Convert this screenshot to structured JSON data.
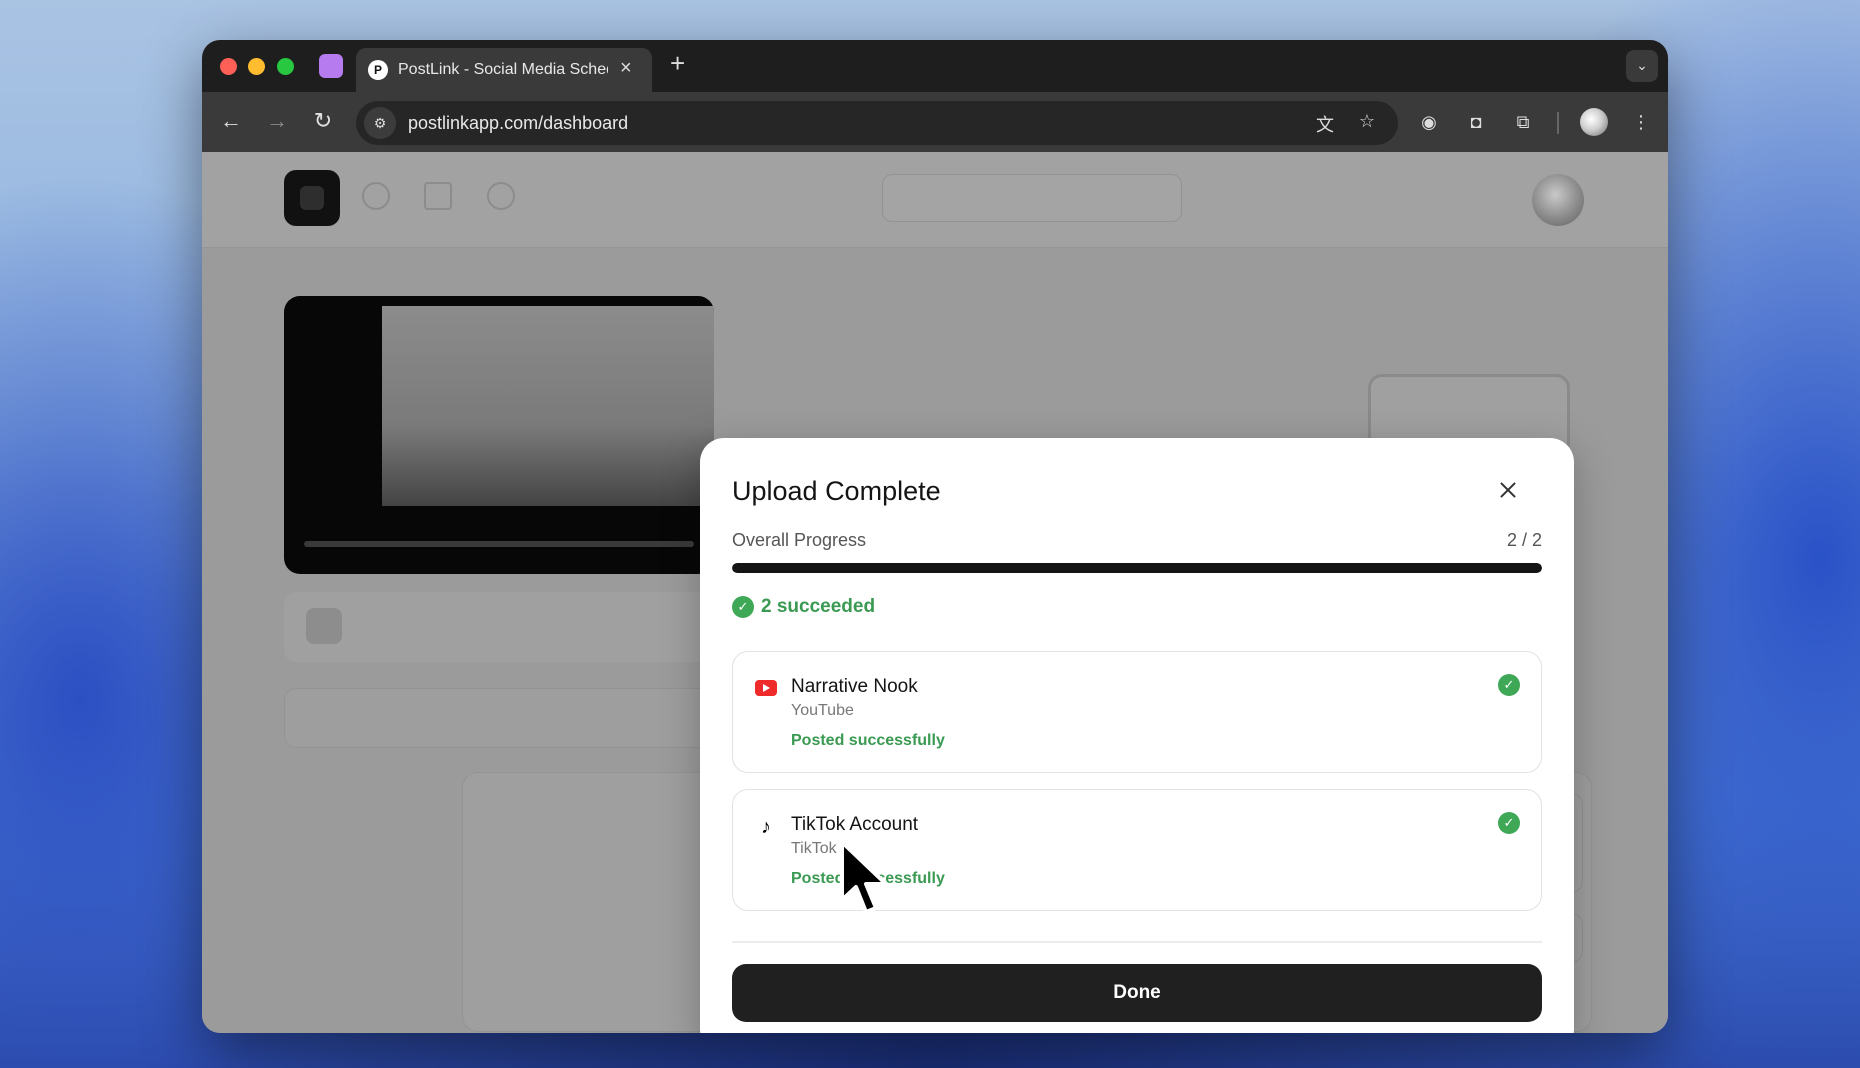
{
  "browser": {
    "tab_title": "PostLink - Social Media Scheduler",
    "tab_favicon": "P",
    "url": "postlinkapp.com/dashboard"
  },
  "modal": {
    "title": "Upload Complete",
    "progress_label": "Overall Progress",
    "progress_count": "2 / 2",
    "progress_fraction": 1.0,
    "summary": "2 succeeded",
    "accounts": [
      {
        "name": "Narrative Nook",
        "platform": "YouTube",
        "status": "Posted successfully",
        "icon": "youtube-icon"
      },
      {
        "name": "TikTok Account",
        "platform": "TikTok",
        "status": "Posted successfully",
        "icon": "tiktok-icon"
      }
    ],
    "done_label": "Done"
  },
  "colors": {
    "success": "#3fa857",
    "primary_button": "#202020",
    "progress_fill": "#141414"
  }
}
